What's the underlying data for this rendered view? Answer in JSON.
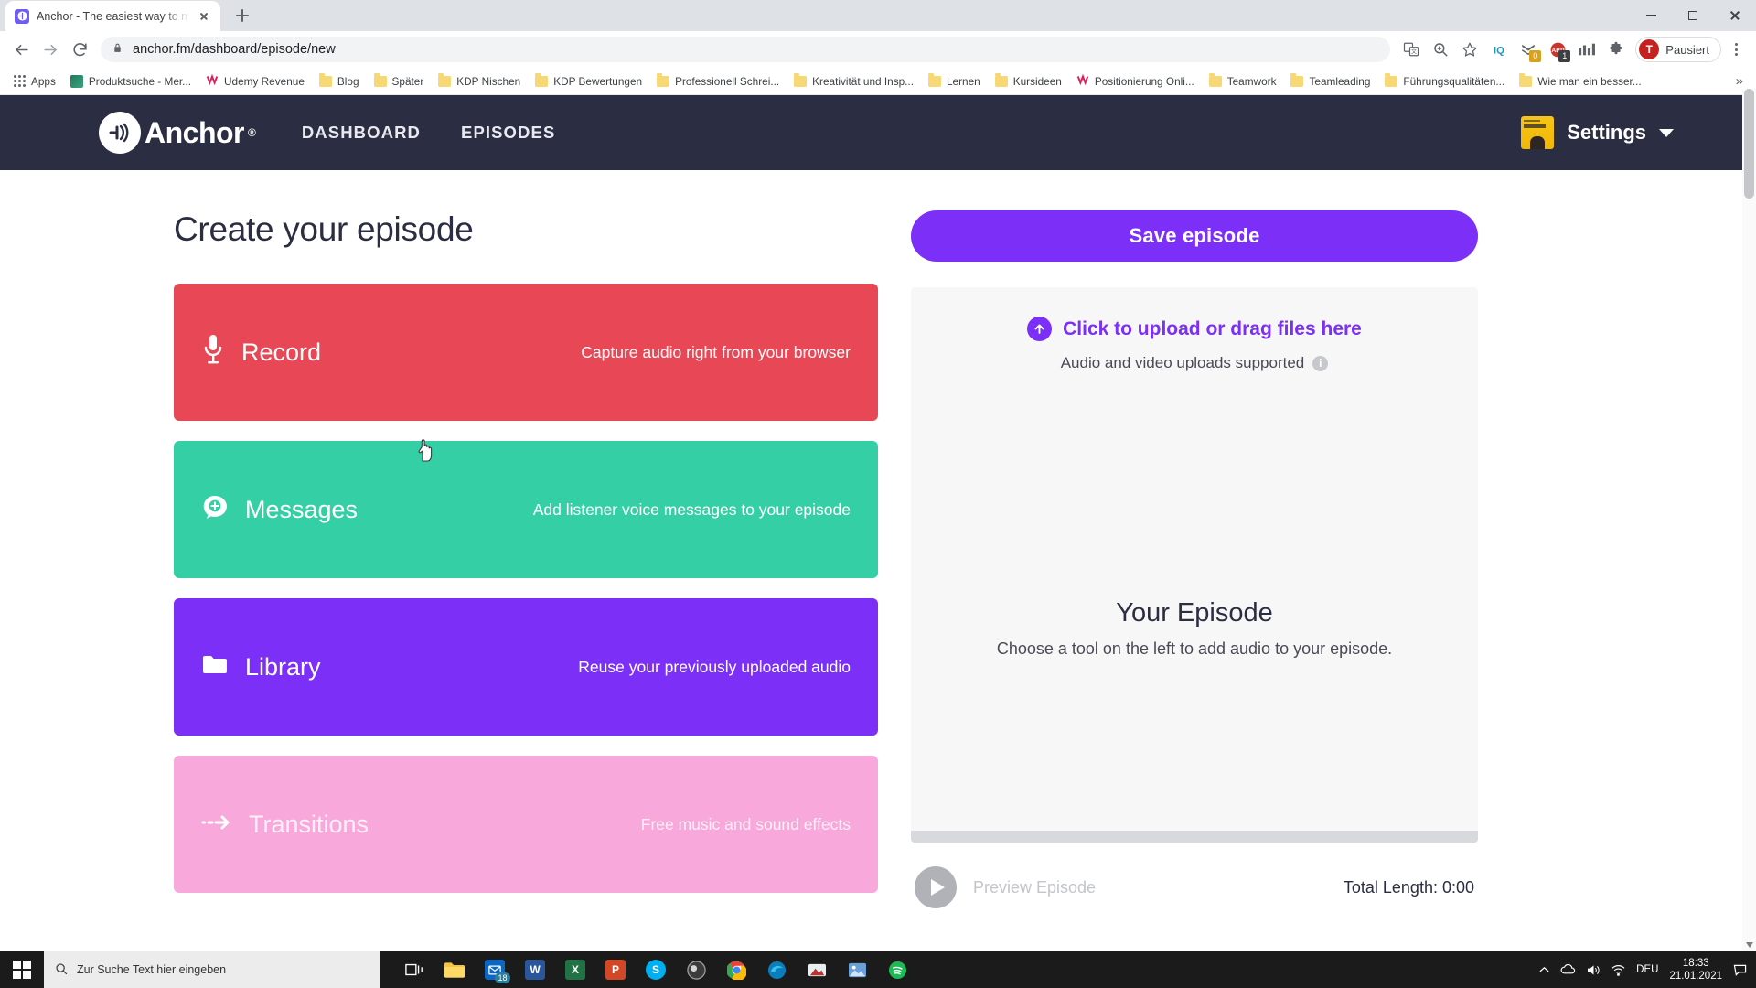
{
  "browser": {
    "tab": {
      "title": "Anchor - The easiest way to mak",
      "favicon": "anchor-favicon"
    },
    "new_tab_label": "+",
    "window_controls": [
      "minimize",
      "maximize",
      "close"
    ],
    "address": "anchor.fm/dashboard/episode/new",
    "nav_icons": [
      "back-arrow",
      "forward-arrow",
      "reload"
    ],
    "lock_icon": "lock-icon",
    "toolbar_icons": [
      {
        "name": "translate-icon",
        "label": ""
      },
      {
        "name": "zoom-icon",
        "label": ""
      },
      {
        "name": "bookmark-star-icon",
        "label": ""
      },
      {
        "name": "iq-extension-icon",
        "label": "IQ"
      },
      {
        "name": "pocket-extension-icon",
        "label": "",
        "badge": "0",
        "badge_color": "#d8a11e"
      },
      {
        "name": "adblock-extension-icon",
        "label": "ABP",
        "badge": "1",
        "badge_color": "#3c4043"
      },
      {
        "name": "grid-extension-icon",
        "label": ""
      },
      {
        "name": "extensions-puzzle-icon",
        "label": ""
      }
    ],
    "profile": {
      "initial": "T",
      "label": "Pausiert",
      "color": "#c5221f"
    },
    "menu_icon": "kebab-menu-icon",
    "bookmarks": [
      {
        "label": "Apps",
        "icon": "apps-grid-icon"
      },
      {
        "label": "Produktsuche - Mer...",
        "icon": "site-thumb-icon",
        "color": "#1f7a5c"
      },
      {
        "label": "Udemy Revenue",
        "icon": "udemy-icon",
        "color": "#d91f5a"
      },
      {
        "label": "Blog",
        "icon": "folder-icon"
      },
      {
        "label": "Später",
        "icon": "folder-icon"
      },
      {
        "label": "KDP Nischen",
        "icon": "folder-icon"
      },
      {
        "label": "KDP Bewertungen",
        "icon": "folder-icon"
      },
      {
        "label": "Professionell Schrei...",
        "icon": "folder-icon"
      },
      {
        "label": "Kreativität und Insp...",
        "icon": "folder-icon"
      },
      {
        "label": "Lernen",
        "icon": "folder-icon"
      },
      {
        "label": "Kursideen",
        "icon": "folder-icon"
      },
      {
        "label": "Positionierung Onli...",
        "icon": "udemy-icon",
        "color": "#d91f5a"
      },
      {
        "label": "Teamwork",
        "icon": "folder-icon"
      },
      {
        "label": "Teamleading",
        "icon": "folder-icon"
      },
      {
        "label": "Führungsqualitäten...",
        "icon": "folder-icon"
      },
      {
        "label": "Wie man ein besser...",
        "icon": "folder-icon"
      }
    ],
    "bookmarks_overflow": "»"
  },
  "app": {
    "brand": {
      "name": "Anchor",
      "registered": "®",
      "logo": "anchor-logo-icon"
    },
    "nav": [
      {
        "label": "DASHBOARD"
      },
      {
        "label": "EPISODES"
      }
    ],
    "settings": {
      "label": "Settings",
      "avatar": "podcast-cover-avatar",
      "caret": "chevron-down-icon"
    },
    "page_title": "Create your episode",
    "tools": [
      {
        "name": "Record",
        "description": "Capture audio right from your browser",
        "icon": "microphone-icon",
        "color": "#e84855"
      },
      {
        "name": "Messages",
        "description": "Add listener voice messages to your episode",
        "icon": "message-plus-icon",
        "color": "#35cfa5"
      },
      {
        "name": "Library",
        "description": "Reuse your previously uploaded audio",
        "icon": "folder-icon",
        "color": "#7b2ff7"
      },
      {
        "name": "Transitions",
        "description": "Free music and sound effects",
        "icon": "arrow-right-icon",
        "color": "#f9a8dc"
      }
    ],
    "save_button": "Save episode",
    "upload": {
      "headline": "Click to upload or drag files here",
      "subtext": "Audio and video uploads supported",
      "icon": "upload-arrow-icon",
      "info_icon": "info-icon",
      "info_glyph": "i"
    },
    "empty_state": {
      "title": "Your Episode",
      "subtitle": "Choose a tool on the left to add audio to your episode."
    },
    "player": {
      "play_icon": "play-icon",
      "preview_label": "Preview Episode",
      "total_length": "Total Length: 0:00"
    },
    "accent_color": "#7b2ff7",
    "nav_background": "#2b2d42"
  },
  "taskbar": {
    "start": "windows-start-icon",
    "search_placeholder": "Zur Suche Text hier eingeben",
    "search_icon": "search-icon",
    "taskview_icon": "task-view-icon",
    "apps": [
      {
        "name": "file-explorer-icon",
        "color": "#f6c344",
        "glyph": ""
      },
      {
        "name": "mail-icon",
        "color": "#0a67c2",
        "glyph": "",
        "badge": "18"
      },
      {
        "name": "word-icon",
        "color": "#2b579a",
        "glyph": "W"
      },
      {
        "name": "excel-icon",
        "color": "#217346",
        "glyph": "X"
      },
      {
        "name": "powerpoint-icon",
        "color": "#d24726",
        "glyph": "P"
      },
      {
        "name": "skype-icon",
        "color": "#00aff0",
        "glyph": "S"
      },
      {
        "name": "obs-icon",
        "color": "#3b3b3b",
        "glyph": ""
      },
      {
        "name": "chrome-icon",
        "color": "#4285f4",
        "glyph": ""
      },
      {
        "name": "edge-icon",
        "color": "#0c7dbb",
        "glyph": ""
      },
      {
        "name": "filezilla-icon",
        "color": "#bf3030",
        "glyph": ""
      },
      {
        "name": "photos-icon",
        "color": "#6aa0d8",
        "glyph": ""
      },
      {
        "name": "spotify-icon",
        "color": "#1db954",
        "glyph": ""
      }
    ],
    "tray": {
      "chevron": "show-hidden-icons",
      "onedrive_icon": "onedrive-icon",
      "volume_icon": "volume-icon",
      "network_icon": "network-icon",
      "language": "DEU",
      "time": "18:33",
      "date": "21.01.2021",
      "notification_icon": "notifications-icon"
    }
  }
}
